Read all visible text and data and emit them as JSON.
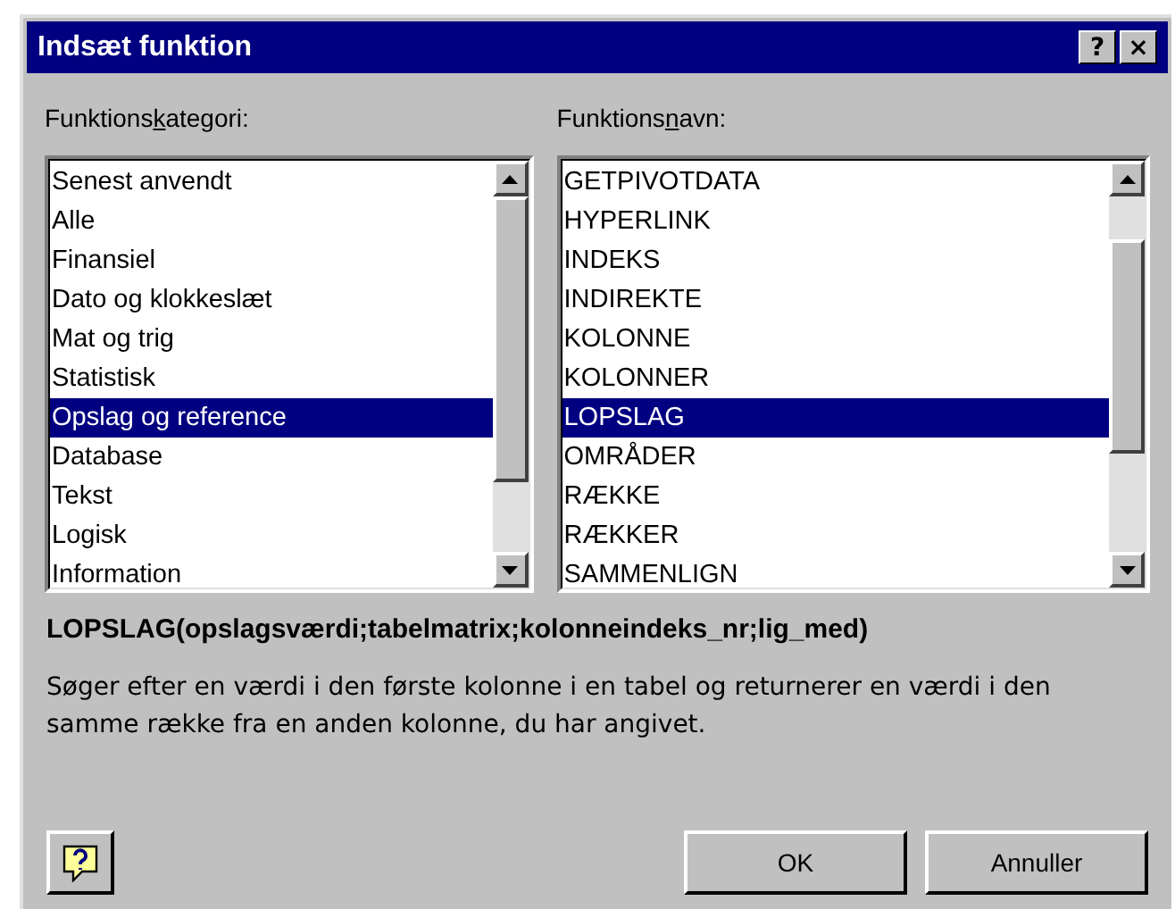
{
  "window": {
    "title": "Indsæt funktion",
    "title_buttons": [
      "?",
      "×"
    ]
  },
  "category_list": {
    "label": {
      "before": "Funktions",
      "key": "k",
      "after": "ategori:"
    },
    "items": [
      {
        "label": "Senest anvendt",
        "selected": false
      },
      {
        "label": "Alle",
        "selected": false
      },
      {
        "label": "Finansiel",
        "selected": false
      },
      {
        "label": "Dato og klokkeslæt",
        "selected": false
      },
      {
        "label": "Mat og trig",
        "selected": false
      },
      {
        "label": "Statistisk",
        "selected": false
      },
      {
        "label": "Opslag og reference",
        "selected": true
      },
      {
        "label": "Database",
        "selected": false
      },
      {
        "label": "Tekst",
        "selected": false
      },
      {
        "label": "Logisk",
        "selected": false
      },
      {
        "label": "Information",
        "selected": false
      }
    ]
  },
  "function_list": {
    "label": {
      "before": "Funktions",
      "key": "n",
      "after": "avn:"
    },
    "items": [
      {
        "label": "GETPIVOTDATA",
        "selected": false
      },
      {
        "label": "HYPERLINK",
        "selected": false
      },
      {
        "label": "INDEKS",
        "selected": false
      },
      {
        "label": "INDIREKTE",
        "selected": false
      },
      {
        "label": "KOLONNE",
        "selected": false
      },
      {
        "label": "KOLONNER",
        "selected": false
      },
      {
        "label": "LOPSLAG",
        "selected": true
      },
      {
        "label": "OMRÅDER",
        "selected": false
      },
      {
        "label": "RÆKKE",
        "selected": false
      },
      {
        "label": "RÆKKER",
        "selected": false
      },
      {
        "label": "SAMMENLIGN",
        "selected": false
      }
    ]
  },
  "signature": "LOPSLAG(opslagsværdi;tabelmatrix;kolonneindeks_nr;lig_med)",
  "description": "Søger efter en værdi i den første kolonne i en tabel og returnerer en værdi i den samme række fra en anden kolonne, du har angivet.",
  "buttons": [
    "OK",
    "Annuller"
  ]
}
